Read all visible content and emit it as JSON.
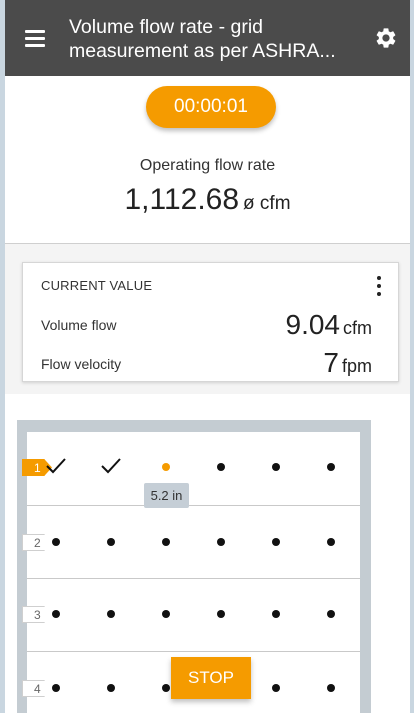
{
  "header": {
    "title_line1": "Volume flow rate - grid",
    "title_line2": "measurement as per ASHRA...",
    "menu_icon": "hamburger-menu-icon",
    "settings_icon": "gear-icon"
  },
  "timer": {
    "value": "00:00:01"
  },
  "operating": {
    "label": "Operating flow rate",
    "value": "1,112.68",
    "unit": "ø cfm"
  },
  "card": {
    "title": "CURRENT VALUE",
    "menu_icon": "more-vert-icon",
    "rows": [
      {
        "label": "Volume flow",
        "value": "9.04",
        "unit": "cfm"
      },
      {
        "label": "Flow velocity",
        "value": "7",
        "unit": "fpm"
      }
    ]
  },
  "grid": {
    "rows": [
      {
        "label": "1",
        "active": true,
        "points": [
          "done",
          "done",
          "active",
          "pending",
          "pending",
          "pending"
        ]
      },
      {
        "label": "2",
        "active": false,
        "points": [
          "pending",
          "pending",
          "pending",
          "pending",
          "pending",
          "pending"
        ]
      },
      {
        "label": "3",
        "active": false,
        "points": [
          "pending",
          "pending",
          "pending",
          "pending",
          "pending",
          "pending"
        ]
      },
      {
        "label": "4",
        "active": false,
        "points": [
          "pending",
          "pending",
          "pending",
          "pending",
          "pending",
          "pending"
        ]
      }
    ],
    "tooltip": "5.2 in"
  },
  "stop_button": {
    "label": "STOP"
  },
  "colors": {
    "accent": "#f59b00",
    "appbar": "#4b4b4b",
    "grid_frame": "#c4ccd2"
  }
}
